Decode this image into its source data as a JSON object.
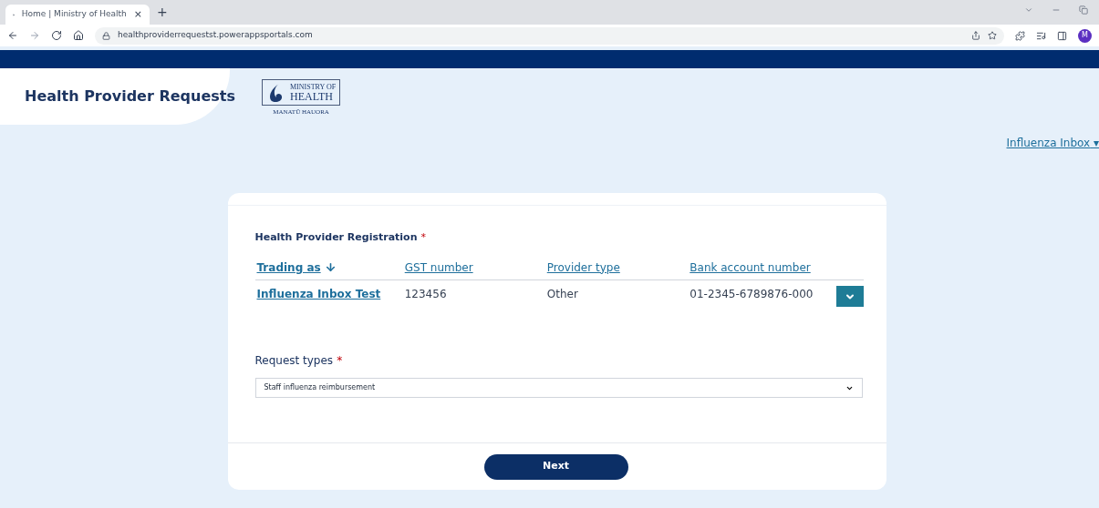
{
  "browser": {
    "tab_title": "Home | Ministry of Health",
    "tab_close": "×",
    "new_tab": "+",
    "url": "healthproviderrequestst.powerappsportals.com",
    "profile_initial": "M"
  },
  "header": {
    "site_title": "Health Provider Requests",
    "logo": {
      "line_1": "MINISTRY OF",
      "line_2": "HEALTH",
      "line_3": "MANATŪ HAUORA"
    },
    "user_menu": "Influenza Inbox",
    "user_menu_caret": "▾"
  },
  "form": {
    "registration_label": "Health Provider Registration",
    "required_mark": "*",
    "table": {
      "columns": [
        {
          "label": "Trading as",
          "sorted": true
        },
        {
          "label": "GST number",
          "sorted": false
        },
        {
          "label": "Provider type",
          "sorted": false
        },
        {
          "label": "Bank account number",
          "sorted": false
        }
      ],
      "rows": [
        {
          "cells": [
            "Influenza Inbox Test",
            "123456",
            "Other",
            "01-2345-6789876-000"
          ]
        }
      ]
    },
    "request_types_label": "Request types",
    "request_types_required": "*",
    "request_type_value": "Staff influenza reimbursement"
  },
  "next_button": "Next"
}
